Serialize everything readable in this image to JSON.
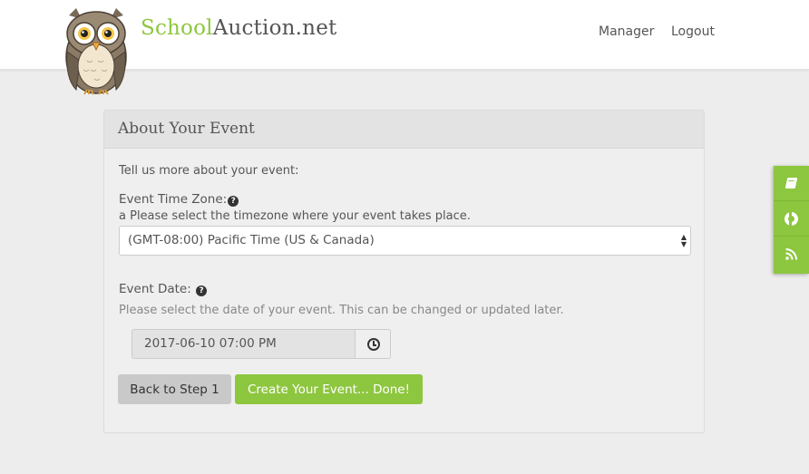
{
  "header": {
    "brand_part1": "School",
    "brand_part2": "Auction.net",
    "nav": [
      {
        "label": "Manager"
      },
      {
        "label": "Logout"
      }
    ]
  },
  "panel": {
    "title": "About Your Event",
    "intro": "Tell us more about your event:",
    "timezone": {
      "label": "Event Time Zone:",
      "help": "a Please select the timezone where your event takes place.",
      "selected": "(GMT-08:00) Pacific Time (US & Canada)"
    },
    "date": {
      "label": "Event Date:",
      "help": "Please select the date of your event. This can be changed or updated later.",
      "value": "2017-06-10 07:00 PM"
    },
    "buttons": {
      "back": "Back to Step 1",
      "create": "Create Your Event... Done!"
    }
  },
  "side_tabs": [
    {
      "icon": "book-icon"
    },
    {
      "icon": "life-ring-icon"
    },
    {
      "icon": "rss-icon"
    }
  ],
  "colors": {
    "brand_green": "#8dc63f",
    "background": "#ededed"
  }
}
